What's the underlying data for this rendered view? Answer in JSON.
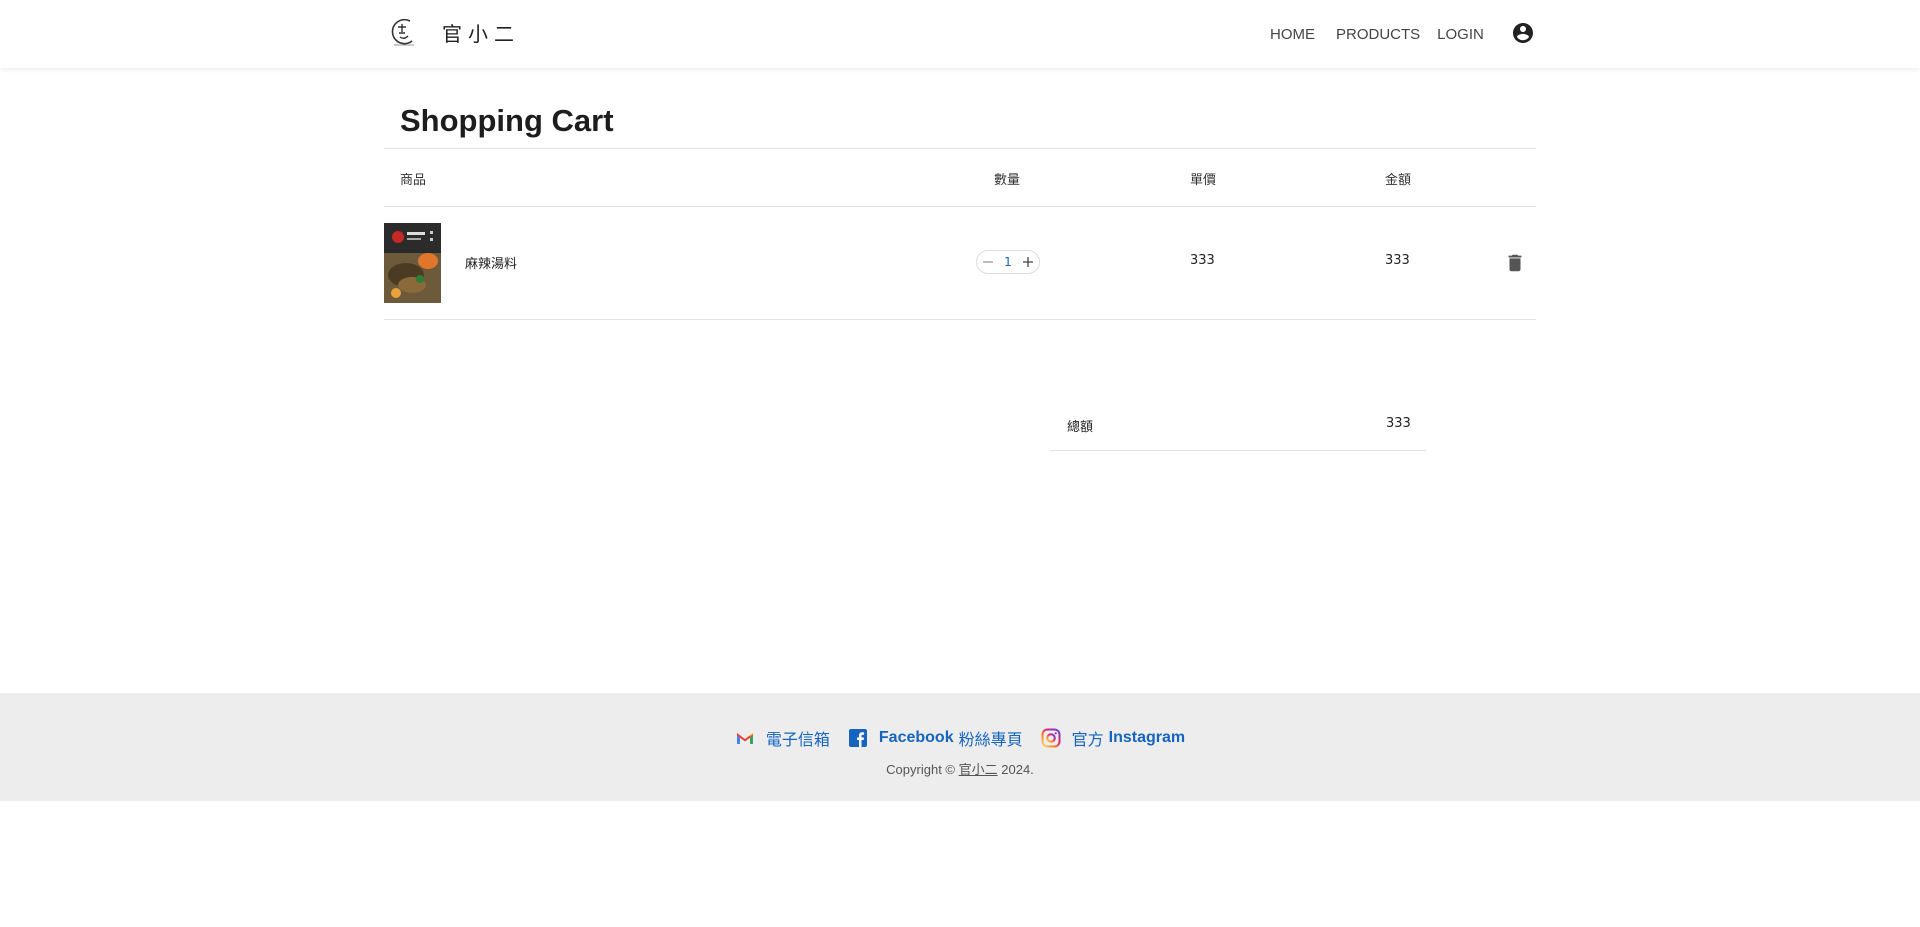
{
  "header": {
    "brand_name": "官小二",
    "nav": {
      "home": "HOME",
      "products": "PRODUCTS",
      "login": "LOGIN"
    }
  },
  "cart": {
    "title": "Shopping Cart",
    "columns": {
      "product": "商品",
      "quantity": "數量",
      "unit_price": "單價",
      "amount": "金額"
    },
    "items": [
      {
        "name": "麻辣湯料",
        "quantity": "1",
        "unit_price": "333",
        "amount": "333"
      }
    ],
    "total_label": "總額",
    "total_value": "333"
  },
  "footer": {
    "email_label": "電子信箱",
    "facebook_label_en": "Facebook",
    "facebook_label_zh": "粉絲專頁",
    "instagram_label_zh": "官方",
    "instagram_label_en": "Instagram",
    "copyright_prefix": "Copyright ©",
    "copyright_link": "官小二",
    "copyright_year": "2024."
  },
  "colors": {
    "accent": "#1565c0",
    "footer_bg": "#ededed",
    "border": "#e3e3e3"
  }
}
